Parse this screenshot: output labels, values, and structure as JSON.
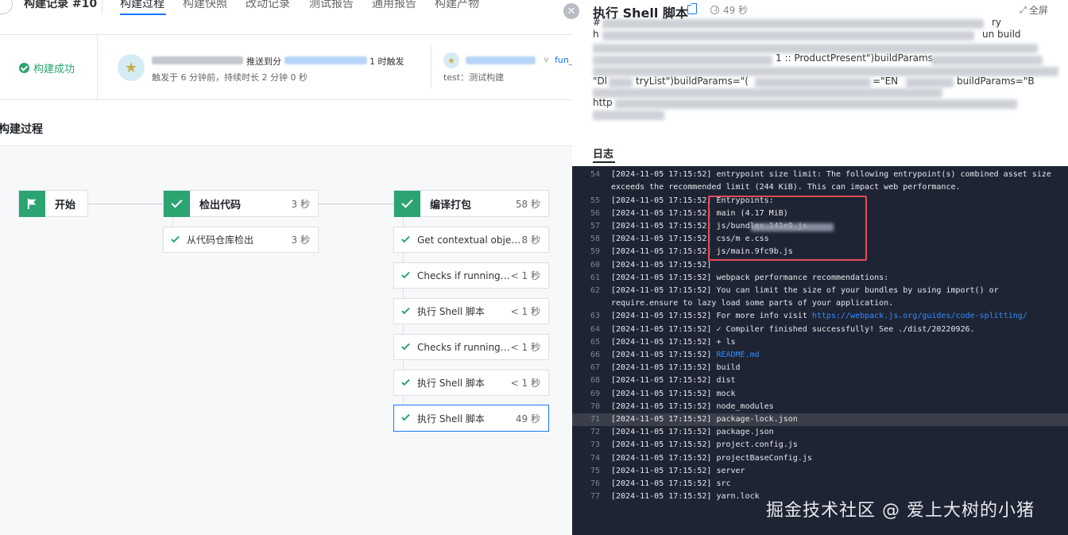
{
  "header": {
    "record_title": "构建记录 #10",
    "tabs": [
      {
        "label": "构建过程"
      },
      {
        "label": "构建快照"
      },
      {
        "label": "改动记录"
      },
      {
        "label": "测试报告"
      },
      {
        "label": "通用报告"
      },
      {
        "label": "构建产物"
      }
    ]
  },
  "summary": {
    "status": "构建成功",
    "trigger_part_1": "推送到分",
    "trigger_part_2": "1 时触发",
    "trigger_meta": "触发于 6 分钟前，持续时长 2 分钟 0 秒",
    "branch": "fun_",
    "test_label": "test：测试构建"
  },
  "process": {
    "title": "构建过程"
  },
  "pipeline": {
    "stages": [
      {
        "label": "开始",
        "duration": ""
      },
      {
        "label": "检出代码",
        "duration": "3 秒"
      },
      {
        "label": "编译打包",
        "duration": "58 秒"
      }
    ],
    "checkout_steps": [
      {
        "label": "从代码仓库检出",
        "duration": "3 秒"
      }
    ],
    "build_steps": [
      {
        "label": "Get contextual object ...",
        "duration": "8 秒"
      },
      {
        "label": "Checks if running o...",
        "duration": "< 1 秒"
      },
      {
        "label": "执行 Shell 脚本",
        "duration": "< 1 秒"
      },
      {
        "label": "Checks if running o...",
        "duration": "< 1 秒"
      },
      {
        "label": "执行 Shell 脚本",
        "duration": "< 1 秒"
      },
      {
        "label": "执行 Shell 脚本",
        "duration": "49 秒"
      }
    ]
  },
  "panel": {
    "title": "执行 Shell 脚本",
    "duration": "49 秒",
    "fullscreen_label": "全屏",
    "command_fragments": {
      "c1": "#",
      "c2": "ry",
      "c3": "h",
      "c4": "un build",
      "c5": "1 :: ProductPresent\")buildParams",
      "c6": "\"Dl",
      "c7": "tryList\")buildParams=\"(",
      "c8": "=\"EN",
      "c9": "buildParams=\"B",
      "c10": "http"
    },
    "log_tab": "日志"
  },
  "log": {
    "lines": [
      {
        "n": "54",
        "t": "[2024-11-05 17:15:52] entrypoint size limit: The following entrypoint(s) combined asset size"
      },
      {
        "n": "",
        "t": "exceeds the recommended limit (244 KiB). This can impact web performance."
      },
      {
        "n": "55",
        "t": "[2024-11-05 17:15:52] Entrypoints:"
      },
      {
        "n": "56",
        "t": "[2024-11-05 17:15:52]   main (4.17 MiB)"
      },
      {
        "n": "57",
        "t": "[2024-11-05 17:15:52]       js/bundles.141e9.js"
      },
      {
        "n": "58",
        "t": "[2024-11-05 17:15:52]       css/m               e.css"
      },
      {
        "n": "59",
        "t": "[2024-11-05 17:15:52]       js/main.9fc9b.js"
      },
      {
        "n": "60",
        "t": "[2024-11-05 17:15:52]"
      },
      {
        "n": "61",
        "t": "[2024-11-05 17:15:52] webpack performance recommendations:"
      },
      {
        "n": "62",
        "t": "[2024-11-05 17:15:52] You can limit the size of your bundles by using import() or"
      },
      {
        "n": "",
        "t": "require.ensure to lazy load some parts of your application."
      },
      {
        "n": "63",
        "t": "[2024-11-05 17:15:52] For more info visit ",
        "link": "https://webpack.js.org/guides/code-splitting/"
      },
      {
        "n": "64",
        "t": "[2024-11-05 17:15:52] ✓ Compiler finished successfully! See ./dist/20220926."
      },
      {
        "n": "65",
        "t": "[2024-11-05 17:15:52] + ls"
      },
      {
        "n": "66",
        "t": "[2024-11-05 17:15:52] ",
        "link": "README.md"
      },
      {
        "n": "67",
        "t": "[2024-11-05 17:15:52] build"
      },
      {
        "n": "68",
        "t": "[2024-11-05 17:15:52] dist"
      },
      {
        "n": "69",
        "t": "[2024-11-05 17:15:52] mock"
      },
      {
        "n": "70",
        "t": "[2024-11-05 17:15:52] node_modules"
      },
      {
        "n": "71",
        "t": "[2024-11-05 17:15:52] package-lock.json",
        "highlight": true
      },
      {
        "n": "72",
        "t": "[2024-11-05 17:15:52] package.json"
      },
      {
        "n": "73",
        "t": "[2024-11-05 17:15:52] project.config.js"
      },
      {
        "n": "74",
        "t": "[2024-11-05 17:15:52] projectBaseConfig.js"
      },
      {
        "n": "75",
        "t": "[2024-11-05 17:15:52] server"
      },
      {
        "n": "76",
        "t": "[2024-11-05 17:15:52] src"
      },
      {
        "n": "77",
        "t": "[2024-11-05 17:15:52] yarn.lock"
      }
    ]
  },
  "watermark": "掘金技术社区 @ 爱上大树的小猪",
  "colors": {
    "success": "#2ba471",
    "primary": "#1677ff",
    "log_bg": "#1e2433",
    "highlight_box": "#e34d59"
  }
}
